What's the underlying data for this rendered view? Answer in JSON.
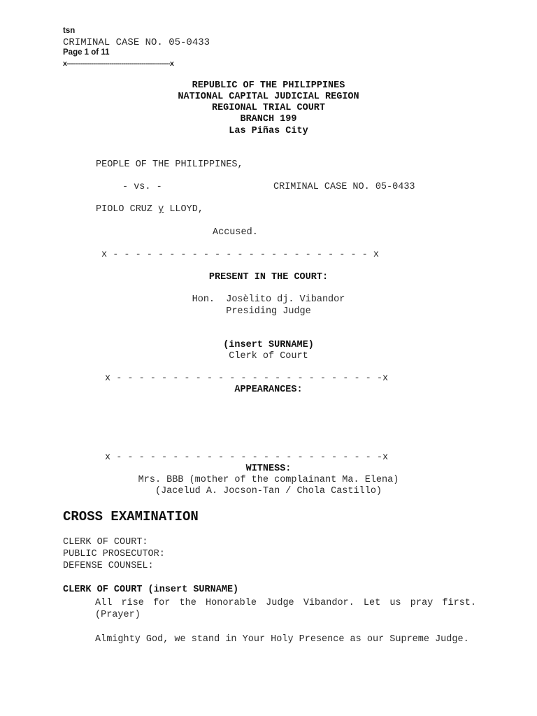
{
  "header": {
    "doc_type": "tsn",
    "case_line": "CRIMINAL CASE NO. 05-0433",
    "page_indicator": "Page 1 of 11",
    "rule": "x---------------------------------------------------x"
  },
  "court": {
    "line1": "REPUBLIC OF THE PHILIPPINES",
    "line2": "NATIONAL CAPITAL JUDICIAL REGION",
    "line3": "REGIONAL TRIAL COURT",
    "line4": "BRANCH 199",
    "line5": "Las Piñas City"
  },
  "caption": {
    "plaintiff": "PEOPLE OF THE PHILIPPINES,",
    "versus": "- vs. -",
    "case_number": "CRIMINAL CASE NO. 05-0433",
    "accused_name_part1": "PIOLO CRUZ ",
    "accused_name_y": "y",
    "accused_name_part2": " LLOYD,",
    "accused_label": "Accused."
  },
  "separators": {
    "sep1": "x - - - - - - - - - - - - - - - - - - - - - - - x",
    "sep2": "x - - - - - - - - - - - - - - - - - - - - - - - -x",
    "sep3": "x - - - - - - - - - - - - - - - - - - - - - - - -x"
  },
  "present": {
    "heading": "PRESENT IN THE COURT:",
    "judge_name": "Hon.  Josèlito dj. Vibandor",
    "judge_title": "Presiding Judge",
    "clerk_name": "(insert SURNAME)",
    "clerk_title": "Clerk of Court"
  },
  "appearances": {
    "heading": "APPEARANCES:"
  },
  "witness": {
    "heading": "WITNESS:",
    "name_line": "Mrs. BBB (mother of the complainant Ma. Elena)",
    "stenographers_line": "(Jacelud A. Jocson-Tan / Chola Castillo)"
  },
  "examination": {
    "title": "CROSS EXAMINATION",
    "roles": [
      "CLERK OF COURT:",
      "PUBLIC PROSECUTOR:",
      "DEFENSE COUNSEL:"
    ],
    "speaker": "CLERK OF COURT (insert SURNAME)",
    "paragraphs": [
      "All rise for the Honorable Judge Vibandor. Let us pray first. (Prayer)",
      "Almighty God, we stand in Your Holy Presence as our Supreme Judge."
    ]
  }
}
